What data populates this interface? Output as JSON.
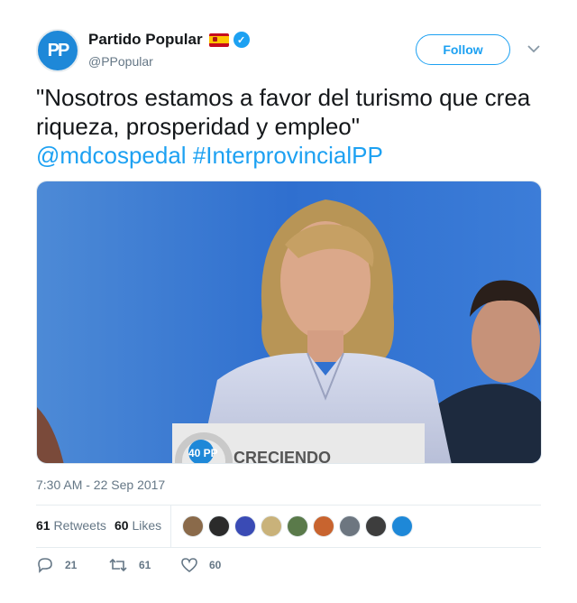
{
  "account": {
    "display_name": "Partido Popular",
    "handle": "@PPopular",
    "avatar_text": "PP",
    "flag_icon": "spain-flag-icon",
    "verified_icon": "verified-badge-icon"
  },
  "follow_button": {
    "label": "Follow"
  },
  "tweet": {
    "text": "\"Nosotros estamos a favor del turismo que crea riqueza, prosperidad y empleo\"",
    "mention": "@mdcospedal",
    "hashtag": "#InterprovincialPP"
  },
  "media": {
    "podium_text": "CRECIENDO",
    "logo_text": "40 PP"
  },
  "timestamp": "7:30 AM - 22 Sep 2017",
  "stats": {
    "retweets_count": "61",
    "retweets_label": "Retweets",
    "likes_count": "60",
    "likes_label": "Likes",
    "liker_colors": [
      "#8a6a4a",
      "#2b2b2b",
      "#3a4bb5",
      "#c9b27a",
      "#5a7a4a",
      "#c8642f",
      "#6d7680",
      "#3d3d3d",
      "#1e88d8"
    ]
  },
  "actions": {
    "replies": "21",
    "retweets": "61",
    "likes": "60"
  },
  "colors": {
    "accent": "#1da1f2",
    "text": "#14171a",
    "secondary": "#657786"
  }
}
